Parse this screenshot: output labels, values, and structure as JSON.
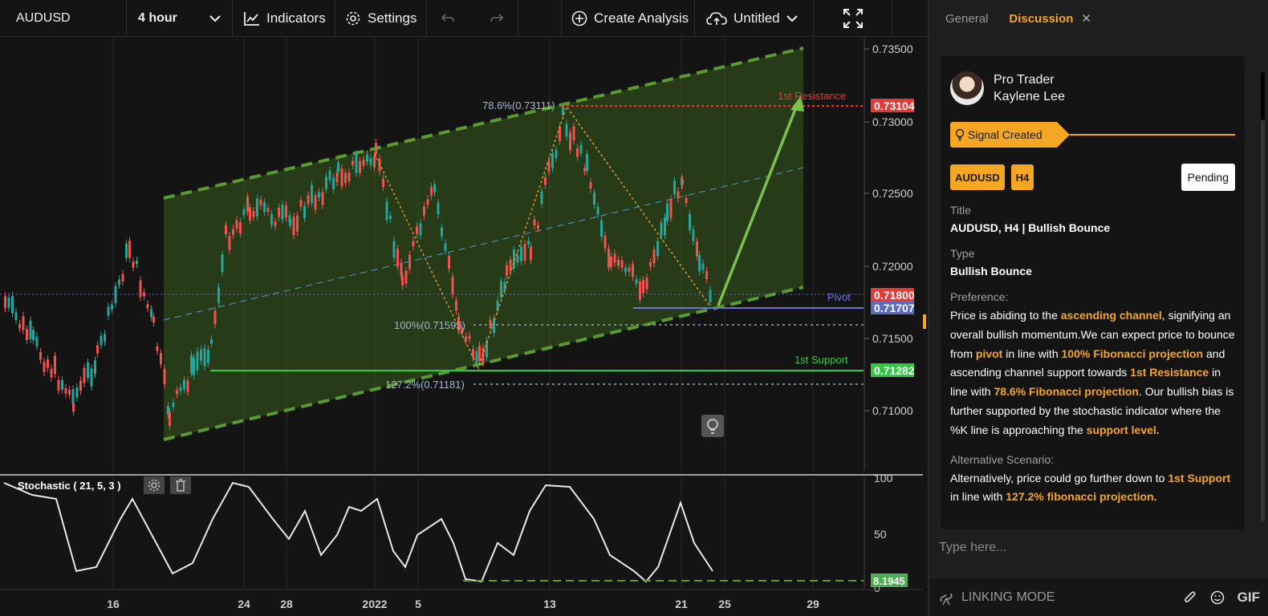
{
  "toolbar": {
    "symbol": "AUDUSD",
    "interval": "4 hour",
    "indicators": "Indicators",
    "settings": "Settings",
    "create_analysis": "Create Analysis",
    "save_name": "Untitled"
  },
  "chart": {
    "price_axis": [
      "0.73500",
      "0.73000",
      "0.72500",
      "0.72000",
      "0.71500",
      "0.71000"
    ],
    "price_tags": {
      "resistance": "0.73104",
      "pivot_upper": "0.71800",
      "pivot": "0.71707",
      "support": "0.71282"
    },
    "labels": {
      "resistance": "1st Resistance",
      "pivot": "Pivot",
      "support": "1st Support",
      "fib_786": "78.6%(0.73111)",
      "fib_100": "100%(0.71593)",
      "fib_1272": "127.2%(0.71181)"
    },
    "stochastic": {
      "title": "Stochastic ( 21, 5, 3 )",
      "axis": [
        "100",
        "50",
        "0"
      ],
      "value": "8.1945"
    },
    "time_axis": [
      "16",
      "24",
      "28",
      "2022",
      "5",
      "13",
      "21",
      "25",
      "29"
    ],
    "colors": {
      "up": "#26a69a",
      "down": "#ef5350",
      "channel": "#4a7c2a",
      "resistance": "#e53935",
      "support": "#2ecc40",
      "pivot": "#5c6bc0",
      "accent": "#f5a623"
    }
  },
  "panel": {
    "tabs": [
      "General",
      "Discussion"
    ],
    "author": {
      "role": "Pro Trader",
      "name": "Kaylene Lee"
    },
    "signal": "Signal Created",
    "tags": [
      "AUDUSD",
      "H4"
    ],
    "status": "Pending",
    "title_label": "Title",
    "title_value": "AUDUSD, H4 | Bullish Bounce",
    "type_label": "Type",
    "type_value": "Bullish Bounce",
    "preference_label": "Preference:",
    "alt_label": "Alternative Scenario:",
    "input_placeholder": "Type here...",
    "linking_mode": "LINKING MODE",
    "gif": "GIF"
  }
}
